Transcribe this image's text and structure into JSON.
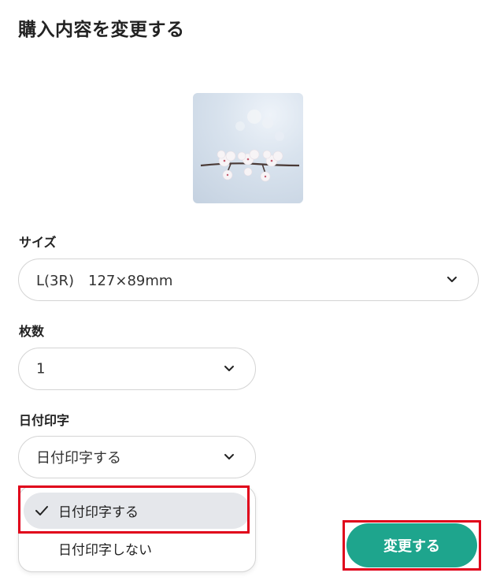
{
  "title": "購入内容を変更する",
  "size": {
    "label": "サイズ",
    "value": "L(3R)　127×89mm"
  },
  "quantity": {
    "label": "枚数",
    "value": "1"
  },
  "date_print": {
    "label": "日付印字",
    "value": "日付印字する",
    "options": [
      {
        "label": "日付印字する",
        "selected": true
      },
      {
        "label": "日付印字しない",
        "selected": false
      }
    ]
  },
  "submit_label": "変更する",
  "colors": {
    "accent": "#1ea58d",
    "highlight": "#e0001a",
    "selected_bg": "#e5e7eb",
    "border": "#d4d4d4"
  },
  "icons": {
    "chevron": "chevron-down-icon",
    "check": "check-icon"
  }
}
